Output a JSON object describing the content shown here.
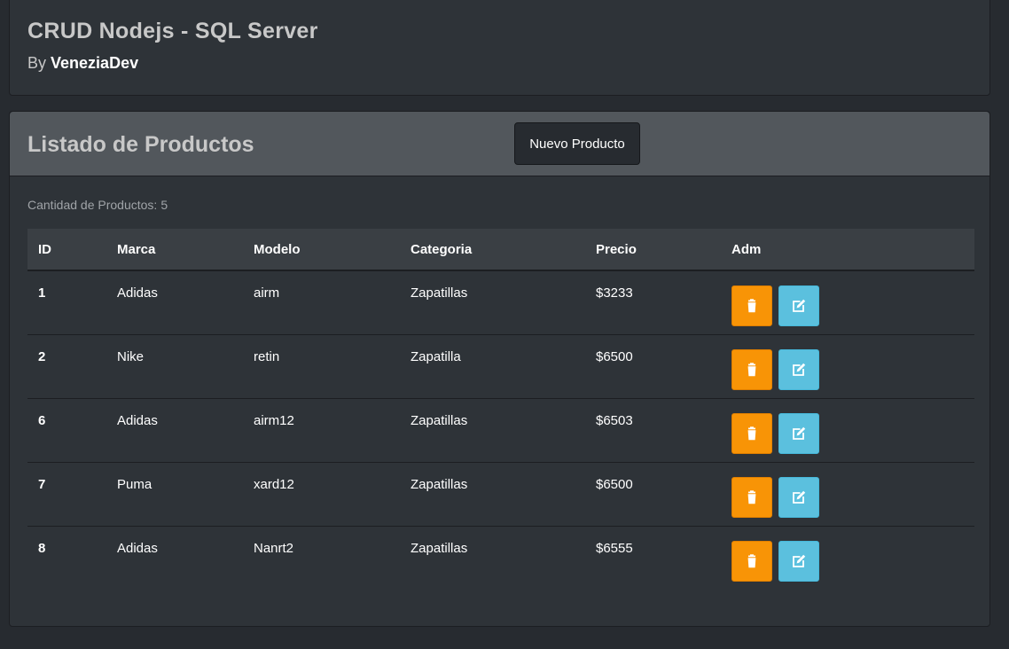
{
  "header": {
    "title": "CRUD Nodejs - SQL Server",
    "byline_prefix": "By",
    "author": "VeneziaDev"
  },
  "products_panel": {
    "title": "Listado de Productos",
    "new_button_label": "Nuevo Producto",
    "count_label": "Cantidad de Productos:",
    "count_value": "5"
  },
  "table": {
    "columns": [
      "ID",
      "Marca",
      "Modelo",
      "Categoria",
      "Precio",
      "Adm"
    ],
    "rows": [
      {
        "id": "1",
        "marca": "Adidas",
        "modelo": "airm",
        "categoria": "Zapatillas",
        "precio": "$3233"
      },
      {
        "id": "2",
        "marca": "Nike",
        "modelo": "retin",
        "categoria": "Zapatilla",
        "precio": "$6500"
      },
      {
        "id": "6",
        "marca": "Adidas",
        "modelo": "airm12",
        "categoria": "Zapatillas",
        "precio": "$6503"
      },
      {
        "id": "7",
        "marca": "Puma",
        "modelo": "xard12",
        "categoria": "Zapatillas",
        "precio": "$6500"
      },
      {
        "id": "8",
        "marca": "Adidas",
        "modelo": "Nanrt2",
        "categoria": "Zapatillas",
        "precio": "$6555"
      }
    ],
    "row_actions": [
      {
        "name": "delete",
        "icon": "trash-icon",
        "color": "#f89406"
      },
      {
        "name": "edit",
        "icon": "edit-icon",
        "color": "#5bc0de"
      }
    ]
  }
}
